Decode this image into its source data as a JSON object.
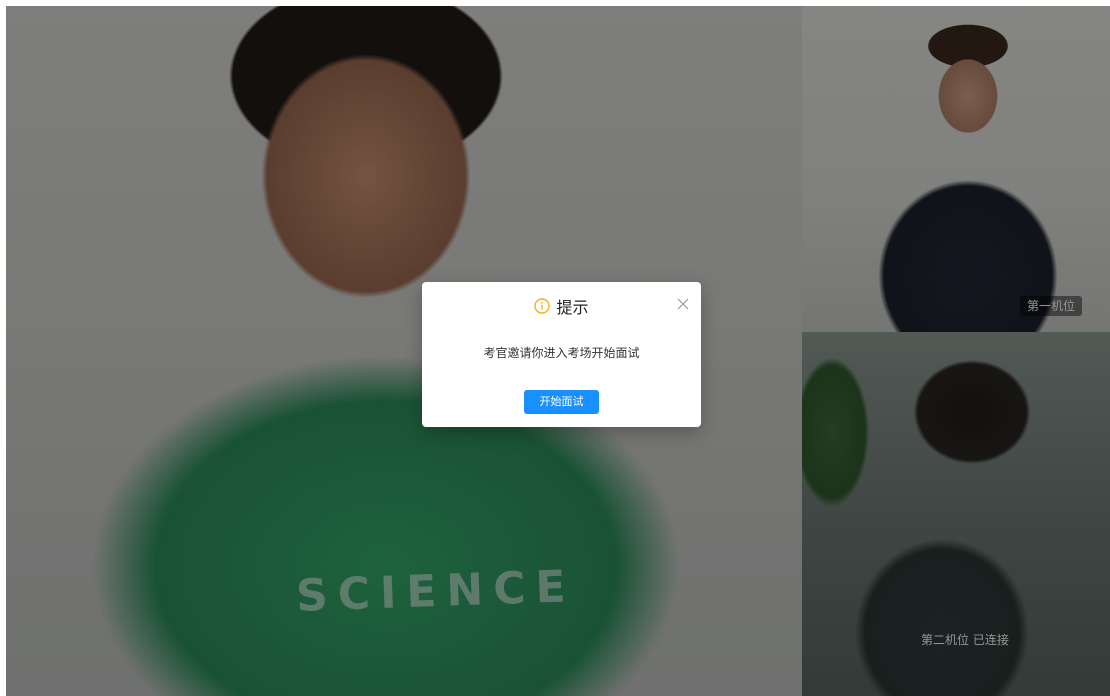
{
  "video_feeds": {
    "main": {
      "shirt_text": "SCIENCE"
    },
    "camera_1": {
      "label": "第一机位"
    },
    "camera_2": {
      "label": "第二机位 已连接"
    }
  },
  "modal": {
    "icon": "info-circle-icon",
    "title": "提示",
    "message": "考官邀请你进入考场开始面试",
    "primary_button": "开始面试",
    "close_icon": "close-icon"
  },
  "colors": {
    "accent": "#1890ff",
    "info_icon": "#faad14"
  }
}
